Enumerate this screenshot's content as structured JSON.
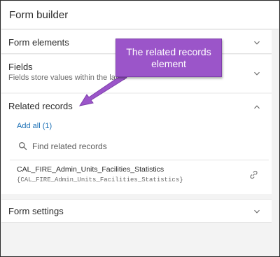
{
  "panel": {
    "title": "Form builder"
  },
  "sections": {
    "form_elements": {
      "title": "Form elements"
    },
    "fields": {
      "title": "Fields",
      "description": "Fields store values within the layer"
    },
    "related_records": {
      "title": "Related records",
      "add_all": "Add all (1)",
      "search_placeholder": "Find related records",
      "items": [
        {
          "name": "CAL_FIRE_Admin_Units_Facilities_Statistics",
          "source": "{CAL_FIRE_Admin_Units_Facilities_Statistics}"
        }
      ]
    },
    "form_settings": {
      "title": "Form settings"
    }
  },
  "annotation": {
    "text": "The related records element",
    "color": "#9b55c9"
  },
  "icons": {
    "collapse": "chevron-down-icon",
    "expand": "chevron-up-icon",
    "search": "search-icon",
    "link": "link-icon"
  },
  "colors": {
    "link": "#1a6fb5",
    "annotation_fill": "#9b55c9"
  }
}
